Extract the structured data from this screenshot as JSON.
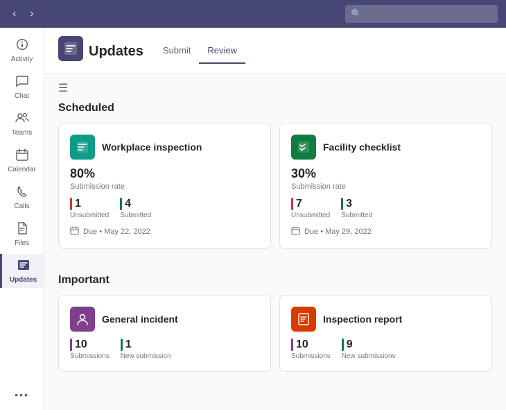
{
  "topbar": {
    "search_placeholder": "Search"
  },
  "sidebar": {
    "items": [
      {
        "id": "activity",
        "label": "Activity",
        "icon": "🔔"
      },
      {
        "id": "chat",
        "label": "Chat",
        "icon": "💬"
      },
      {
        "id": "teams",
        "label": "Teams",
        "icon": "👥"
      },
      {
        "id": "calendar",
        "label": "Calendar",
        "icon": "📅"
      },
      {
        "id": "calls",
        "label": "Calls",
        "icon": "📞"
      },
      {
        "id": "files",
        "label": "Files",
        "icon": "📄"
      },
      {
        "id": "updates",
        "label": "Updates",
        "icon": "📋",
        "active": true
      }
    ],
    "more_label": "•••"
  },
  "header": {
    "icon": "📋",
    "title": "Updates",
    "tabs": [
      {
        "id": "submit",
        "label": "Submit",
        "active": false
      },
      {
        "id": "review",
        "label": "Review",
        "active": true
      }
    ]
  },
  "scheduled": {
    "section_title": "Scheduled",
    "cards": [
      {
        "id": "workplace",
        "icon": "📋",
        "icon_bg": "teal",
        "title": "Workplace inspection",
        "rate_percent": "80%",
        "rate_label": "Submission rate",
        "stats": [
          {
            "value": "1",
            "label": "Unsubmitted",
            "bar_color": "red"
          },
          {
            "value": "4",
            "label": "Submitted",
            "bar_color": "green"
          }
        ],
        "due": "Due • May 22, 2022"
      },
      {
        "id": "facility",
        "icon": "📋",
        "icon_bg": "green",
        "title": "Facility checklist",
        "rate_percent": "30%",
        "rate_label": "Submission rate",
        "stats": [
          {
            "value": "7",
            "label": "Unsubmitted",
            "bar_color": "red"
          },
          {
            "value": "3",
            "label": "Submitted",
            "bar_color": "green"
          }
        ],
        "due": "Due • May 29, 2022"
      }
    ]
  },
  "important": {
    "section_title": "Important",
    "cards": [
      {
        "id": "general-incident",
        "icon": "👤",
        "icon_bg": "purple",
        "title": "General incident",
        "stats": [
          {
            "value": "10",
            "label": "Submissions",
            "bar_color": "purple"
          },
          {
            "value": "1",
            "label": "New submission",
            "bar_color": "green"
          }
        ]
      },
      {
        "id": "inspection-report",
        "icon": "📋",
        "icon_bg": "orange",
        "title": "Inspection report",
        "stats": [
          {
            "value": "10",
            "label": "Submissions",
            "bar_color": "purple"
          },
          {
            "value": "9",
            "label": "New submissions",
            "bar_color": "green"
          }
        ]
      }
    ]
  }
}
